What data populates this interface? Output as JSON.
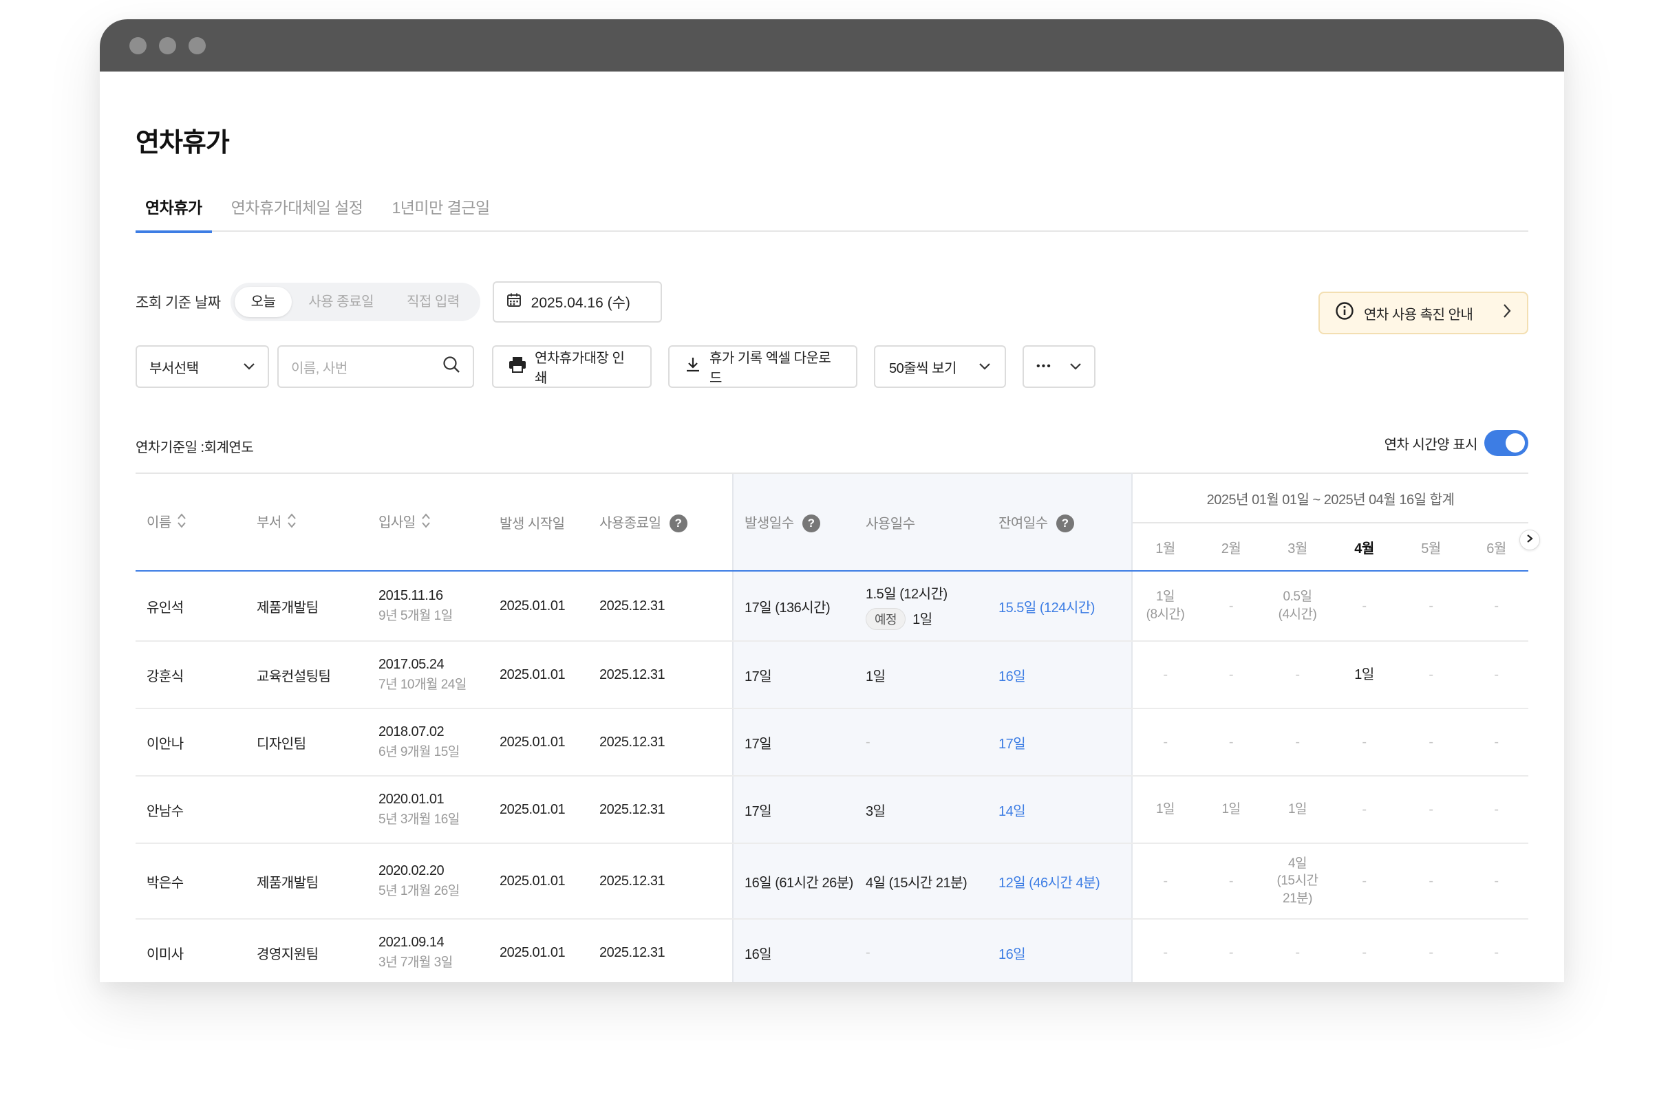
{
  "window": {
    "dots": [
      "close",
      "minimize",
      "maximize"
    ]
  },
  "page_title": "연차휴가",
  "tabs": [
    {
      "label": "연차휴가",
      "active": true
    },
    {
      "label": "연차휴가대체일 설정",
      "active": false
    },
    {
      "label": "1년미만 결근일",
      "active": false
    }
  ],
  "filters": {
    "date_basis_label": "조회 기준 날짜",
    "date_basis_options": [
      "오늘",
      "사용 종료일",
      "직접 입력"
    ],
    "date_basis_selected": "오늘",
    "date_value": "2025.04.16 (수)",
    "promo_label": "연차 사용 촉진 안내",
    "department_select": "부서선택",
    "search_placeholder": "이름, 사번",
    "print_button": "연차휴가대장 인쇄",
    "download_button": "휴가 기록 엑셀 다운로드",
    "page_size_select": "50줄씩 보기",
    "more_button": "•••"
  },
  "basis_text": "연차기준일 :회계연도",
  "toggle": {
    "label": "연차 시간양 표시",
    "on": true
  },
  "table": {
    "headers": {
      "name": "이름",
      "dept": "부서",
      "hire_date": "입사일",
      "start_date": "발생 시작일",
      "end_date": "사용종료일",
      "granted": "발생일수",
      "used": "사용일수",
      "remaining": "잔여일수",
      "summary": "2025년 01월 01일 ~ 2025년 04월 16일 합계",
      "months": [
        "1월",
        "2월",
        "3월",
        "4월",
        "5월",
        "6월"
      ],
      "current_month": "4월"
    },
    "rows": [
      {
        "name": "유인석",
        "dept": "제품개발팀",
        "hire": "2015.11.16",
        "tenure": "9년 5개월 1일",
        "start": "2025.01.01",
        "end": "2025.12.31",
        "granted": "17일 (136시간)",
        "used": "1.5일 (12시간)",
        "planned_badge": "예정",
        "planned": "1일",
        "remaining": "15.5일 (124시간)",
        "months": [
          "1일\n(8시간)",
          "-",
          "0.5일\n(4시간)",
          "-",
          "-",
          "-"
        ]
      },
      {
        "name": "강훈식",
        "dept": "교육컨설팅팀",
        "hire": "2017.05.24",
        "tenure": "7년 10개월 24일",
        "start": "2025.01.01",
        "end": "2025.12.31",
        "granted": "17일",
        "used": "1일",
        "planned_badge": "",
        "planned": "",
        "remaining": "16일",
        "months": [
          "-",
          "-",
          "-",
          "1일",
          "-",
          "-"
        ]
      },
      {
        "name": "이안나",
        "dept": "디자인팀",
        "hire": "2018.07.02",
        "tenure": "6년 9개월 15일",
        "start": "2025.01.01",
        "end": "2025.12.31",
        "granted": "17일",
        "used": "-",
        "planned_badge": "",
        "planned": "",
        "remaining": "17일",
        "months": [
          "-",
          "-",
          "-",
          "-",
          "-",
          "-"
        ]
      },
      {
        "name": "안남수",
        "dept": "",
        "hire": "2020.01.01",
        "tenure": "5년 3개월 16일",
        "start": "2025.01.01",
        "end": "2025.12.31",
        "granted": "17일",
        "used": "3일",
        "planned_badge": "",
        "planned": "",
        "remaining": "14일",
        "months": [
          "1일",
          "1일",
          "1일",
          "-",
          "-",
          "-"
        ]
      },
      {
        "name": "박은수",
        "dept": "제품개발팀",
        "hire": "2020.02.20",
        "tenure": "5년 1개월 26일",
        "start": "2025.01.01",
        "end": "2025.12.31",
        "granted": "16일 (61시간 26분)",
        "used": "4일 (15시간 21분)",
        "planned_badge": "",
        "planned": "",
        "remaining": "12일 (46시간 4분)",
        "months": [
          "-",
          "-",
          "4일\n(15시간\n21분)",
          "-",
          "-",
          "-"
        ]
      },
      {
        "name": "이미사",
        "dept": "경영지원팀",
        "hire": "2021.09.14",
        "tenure": "3년 7개월 3일",
        "start": "2025.01.01",
        "end": "2025.12.31",
        "granted": "16일",
        "used": "-",
        "planned_badge": "",
        "planned": "",
        "remaining": "16일",
        "months": [
          "-",
          "-",
          "-",
          "-",
          "-",
          "-"
        ]
      }
    ]
  },
  "colors": {
    "accent": "#3d7de4",
    "titlebar": "#555555",
    "promo_bg": "#fff7e6",
    "shade": "#f5f7fb"
  }
}
